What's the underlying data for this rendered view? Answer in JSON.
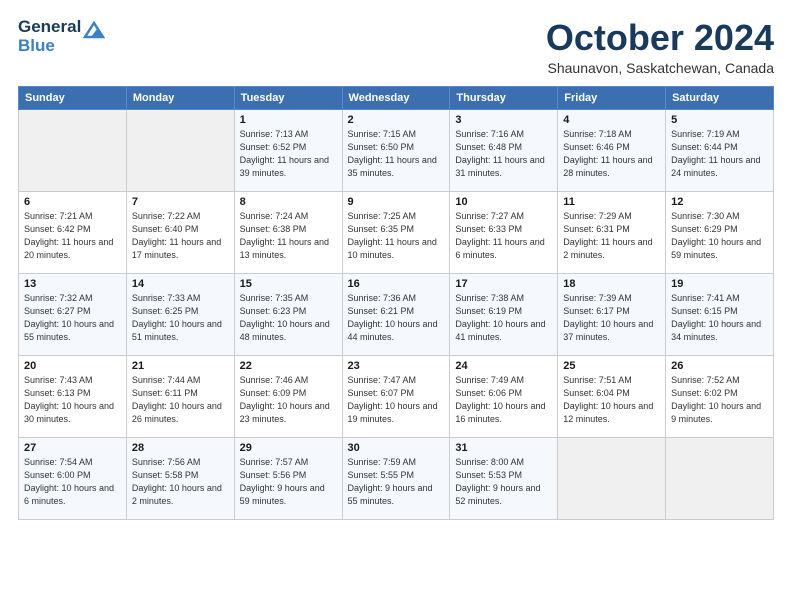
{
  "header": {
    "logo_general": "General",
    "logo_blue": "Blue",
    "month_title": "October 2024",
    "location": "Shaunavon, Saskatchewan, Canada"
  },
  "weekdays": [
    "Sunday",
    "Monday",
    "Tuesday",
    "Wednesday",
    "Thursday",
    "Friday",
    "Saturday"
  ],
  "weeks": [
    [
      {
        "day": "",
        "sunrise": "",
        "sunset": "",
        "daylight": ""
      },
      {
        "day": "",
        "sunrise": "",
        "sunset": "",
        "daylight": ""
      },
      {
        "day": "1",
        "sunrise": "Sunrise: 7:13 AM",
        "sunset": "Sunset: 6:52 PM",
        "daylight": "Daylight: 11 hours and 39 minutes."
      },
      {
        "day": "2",
        "sunrise": "Sunrise: 7:15 AM",
        "sunset": "Sunset: 6:50 PM",
        "daylight": "Daylight: 11 hours and 35 minutes."
      },
      {
        "day": "3",
        "sunrise": "Sunrise: 7:16 AM",
        "sunset": "Sunset: 6:48 PM",
        "daylight": "Daylight: 11 hours and 31 minutes."
      },
      {
        "day": "4",
        "sunrise": "Sunrise: 7:18 AM",
        "sunset": "Sunset: 6:46 PM",
        "daylight": "Daylight: 11 hours and 28 minutes."
      },
      {
        "day": "5",
        "sunrise": "Sunrise: 7:19 AM",
        "sunset": "Sunset: 6:44 PM",
        "daylight": "Daylight: 11 hours and 24 minutes."
      }
    ],
    [
      {
        "day": "6",
        "sunrise": "Sunrise: 7:21 AM",
        "sunset": "Sunset: 6:42 PM",
        "daylight": "Daylight: 11 hours and 20 minutes."
      },
      {
        "day": "7",
        "sunrise": "Sunrise: 7:22 AM",
        "sunset": "Sunset: 6:40 PM",
        "daylight": "Daylight: 11 hours and 17 minutes."
      },
      {
        "day": "8",
        "sunrise": "Sunrise: 7:24 AM",
        "sunset": "Sunset: 6:38 PM",
        "daylight": "Daylight: 11 hours and 13 minutes."
      },
      {
        "day": "9",
        "sunrise": "Sunrise: 7:25 AM",
        "sunset": "Sunset: 6:35 PM",
        "daylight": "Daylight: 11 hours and 10 minutes."
      },
      {
        "day": "10",
        "sunrise": "Sunrise: 7:27 AM",
        "sunset": "Sunset: 6:33 PM",
        "daylight": "Daylight: 11 hours and 6 minutes."
      },
      {
        "day": "11",
        "sunrise": "Sunrise: 7:29 AM",
        "sunset": "Sunset: 6:31 PM",
        "daylight": "Daylight: 11 hours and 2 minutes."
      },
      {
        "day": "12",
        "sunrise": "Sunrise: 7:30 AM",
        "sunset": "Sunset: 6:29 PM",
        "daylight": "Daylight: 10 hours and 59 minutes."
      }
    ],
    [
      {
        "day": "13",
        "sunrise": "Sunrise: 7:32 AM",
        "sunset": "Sunset: 6:27 PM",
        "daylight": "Daylight: 10 hours and 55 minutes."
      },
      {
        "day": "14",
        "sunrise": "Sunrise: 7:33 AM",
        "sunset": "Sunset: 6:25 PM",
        "daylight": "Daylight: 10 hours and 51 minutes."
      },
      {
        "day": "15",
        "sunrise": "Sunrise: 7:35 AM",
        "sunset": "Sunset: 6:23 PM",
        "daylight": "Daylight: 10 hours and 48 minutes."
      },
      {
        "day": "16",
        "sunrise": "Sunrise: 7:36 AM",
        "sunset": "Sunset: 6:21 PM",
        "daylight": "Daylight: 10 hours and 44 minutes."
      },
      {
        "day": "17",
        "sunrise": "Sunrise: 7:38 AM",
        "sunset": "Sunset: 6:19 PM",
        "daylight": "Daylight: 10 hours and 41 minutes."
      },
      {
        "day": "18",
        "sunrise": "Sunrise: 7:39 AM",
        "sunset": "Sunset: 6:17 PM",
        "daylight": "Daylight: 10 hours and 37 minutes."
      },
      {
        "day": "19",
        "sunrise": "Sunrise: 7:41 AM",
        "sunset": "Sunset: 6:15 PM",
        "daylight": "Daylight: 10 hours and 34 minutes."
      }
    ],
    [
      {
        "day": "20",
        "sunrise": "Sunrise: 7:43 AM",
        "sunset": "Sunset: 6:13 PM",
        "daylight": "Daylight: 10 hours and 30 minutes."
      },
      {
        "day": "21",
        "sunrise": "Sunrise: 7:44 AM",
        "sunset": "Sunset: 6:11 PM",
        "daylight": "Daylight: 10 hours and 26 minutes."
      },
      {
        "day": "22",
        "sunrise": "Sunrise: 7:46 AM",
        "sunset": "Sunset: 6:09 PM",
        "daylight": "Daylight: 10 hours and 23 minutes."
      },
      {
        "day": "23",
        "sunrise": "Sunrise: 7:47 AM",
        "sunset": "Sunset: 6:07 PM",
        "daylight": "Daylight: 10 hours and 19 minutes."
      },
      {
        "day": "24",
        "sunrise": "Sunrise: 7:49 AM",
        "sunset": "Sunset: 6:06 PM",
        "daylight": "Daylight: 10 hours and 16 minutes."
      },
      {
        "day": "25",
        "sunrise": "Sunrise: 7:51 AM",
        "sunset": "Sunset: 6:04 PM",
        "daylight": "Daylight: 10 hours and 12 minutes."
      },
      {
        "day": "26",
        "sunrise": "Sunrise: 7:52 AM",
        "sunset": "Sunset: 6:02 PM",
        "daylight": "Daylight: 10 hours and 9 minutes."
      }
    ],
    [
      {
        "day": "27",
        "sunrise": "Sunrise: 7:54 AM",
        "sunset": "Sunset: 6:00 PM",
        "daylight": "Daylight: 10 hours and 6 minutes."
      },
      {
        "day": "28",
        "sunrise": "Sunrise: 7:56 AM",
        "sunset": "Sunset: 5:58 PM",
        "daylight": "Daylight: 10 hours and 2 minutes."
      },
      {
        "day": "29",
        "sunrise": "Sunrise: 7:57 AM",
        "sunset": "Sunset: 5:56 PM",
        "daylight": "Daylight: 9 hours and 59 minutes."
      },
      {
        "day": "30",
        "sunrise": "Sunrise: 7:59 AM",
        "sunset": "Sunset: 5:55 PM",
        "daylight": "Daylight: 9 hours and 55 minutes."
      },
      {
        "day": "31",
        "sunrise": "Sunrise: 8:00 AM",
        "sunset": "Sunset: 5:53 PM",
        "daylight": "Daylight: 9 hours and 52 minutes."
      },
      {
        "day": "",
        "sunrise": "",
        "sunset": "",
        "daylight": ""
      },
      {
        "day": "",
        "sunrise": "",
        "sunset": "",
        "daylight": ""
      }
    ]
  ]
}
